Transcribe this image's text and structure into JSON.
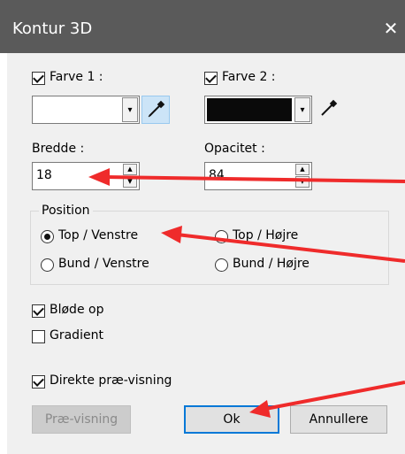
{
  "window": {
    "title": "Kontur 3D",
    "close_glyph": "✕"
  },
  "color1": {
    "label": "Farve 1 :",
    "checked": true,
    "swatch": "#ffffff"
  },
  "color2": {
    "label": "Farve 2 :",
    "checked": true,
    "swatch": "#0a0a0a"
  },
  "width_field": {
    "label": "Bredde :",
    "value": "18"
  },
  "opacity_field": {
    "label": "Opacitet :",
    "value": "84"
  },
  "position": {
    "label": "Position",
    "options": [
      {
        "label": "Top / Venstre",
        "selected": true
      },
      {
        "label": "Top / Højre",
        "selected": false
      },
      {
        "label": "Bund / Venstre",
        "selected": false
      },
      {
        "label": "Bund / Højre",
        "selected": false
      }
    ]
  },
  "soften": {
    "label": "Bløde op",
    "checked": true
  },
  "gradient": {
    "label": "Gradient",
    "checked": false
  },
  "live_preview": {
    "label": "Direkte præ-visning",
    "checked": true
  },
  "buttons": {
    "preview": "Præ-visning",
    "ok": "Ok",
    "cancel": "Annullere"
  },
  "icons": {
    "dropdown": "▾",
    "spin_up": "▲",
    "spin_down": "▼"
  },
  "colors": {
    "annotation_arrow": "#ef2b2b",
    "accent": "#0078d7"
  }
}
